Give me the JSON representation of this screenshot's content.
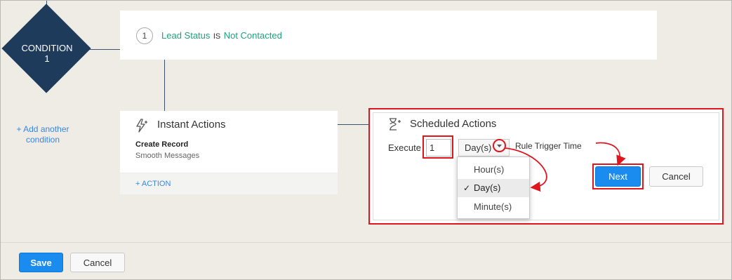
{
  "condition": {
    "shape_label_line1": "CONDITION",
    "shape_label_line2": "1",
    "number": "1",
    "field": "Lead Status",
    "operator": "IS",
    "value": "Not Contacted"
  },
  "add_condition": {
    "line1": "+ Add another",
    "line2": "condition"
  },
  "instant_actions": {
    "title": "Instant Actions",
    "record_title": "Create Record",
    "record_subtitle": "Smooth Messages",
    "add_action": "+ ACTION"
  },
  "scheduled_actions": {
    "title": "Scheduled Actions",
    "execute_label": "Execute",
    "execute_value": "1",
    "unit_selected": "Day(s)",
    "trigger_label": "Rule Trigger Time",
    "unit_options": [
      "Hour(s)",
      "Day(s)",
      "Minute(s)"
    ],
    "selected_mark": "✓",
    "next_button": "Next",
    "cancel_button": "Cancel"
  },
  "footer": {
    "save_button": "Save",
    "cancel_button": "Cancel"
  },
  "colors": {
    "accent_blue": "#1a8cf0",
    "condition_value_green": "#20a27a",
    "diamond_navy": "#1f3b5c",
    "annotation_red": "#e0151d"
  }
}
